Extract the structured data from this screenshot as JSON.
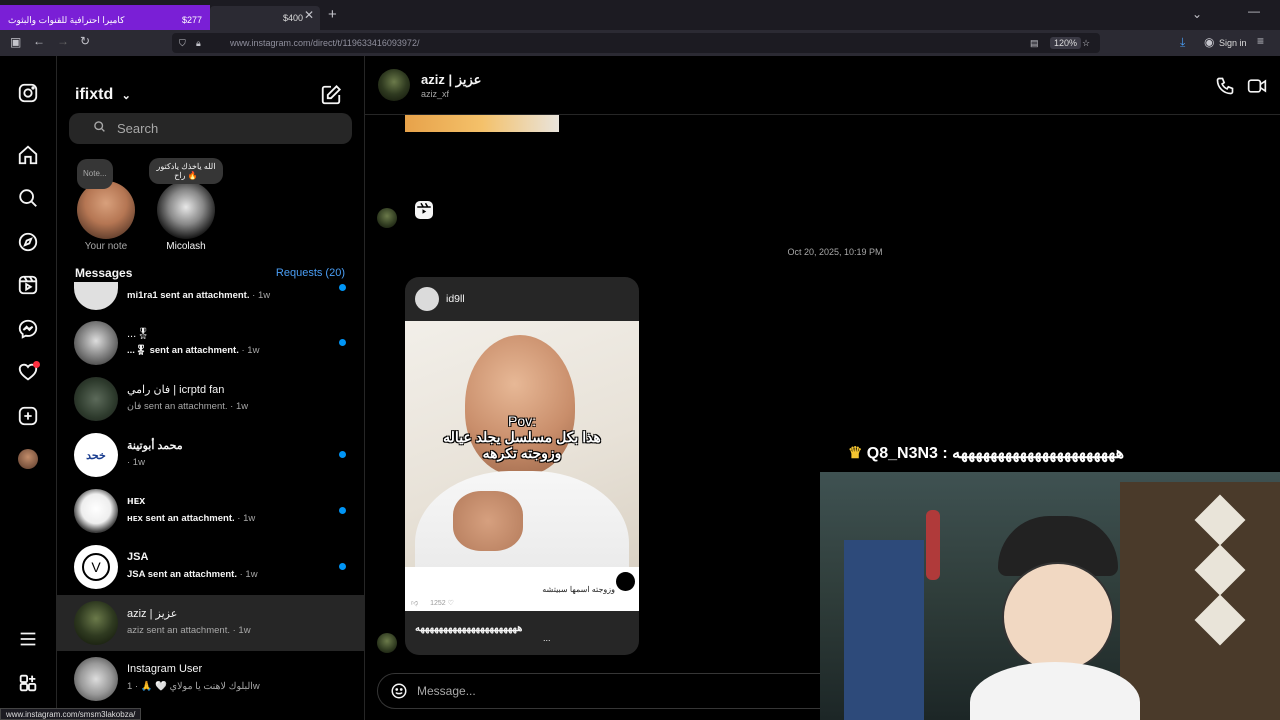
{
  "browser": {
    "ad": {
      "text": "كاميرا احترافية للقنوات والبثوث",
      "price": "$277"
    },
    "tab_price": "$400",
    "url": "www.instagram.com/direct/t/119633416093972/",
    "zoom": "120%",
    "sign_in": "Sign in",
    "status_url": "www.instagram.com/smsm3lakobza/"
  },
  "sidebar": {
    "username": "ifixtd",
    "search_placeholder": "Search",
    "notes": [
      {
        "bubble": "Note...",
        "label": "Your note"
      },
      {
        "bubble": "الله ياخذك يادكتور راح 🔥",
        "label": "Micolash"
      }
    ],
    "messages_heading": "Messages",
    "requests": "Requests (20)",
    "conversations": [
      {
        "name": "",
        "sub": "mi1ra1 sent an attachment.",
        "time": "· 1w",
        "unread": true
      },
      {
        "name": "...🎖",
        "sub": "...🎖 sent an attachment.",
        "time": "· 1w",
        "unread": true
      },
      {
        "name": "فان رامي | icrptd fan",
        "sub": "فان sent an attachment.",
        "time": "· 1w",
        "unread": false
      },
      {
        "name": "محمد أبوتينة",
        "sub": "",
        "time": "· 1w",
        "unread": true
      },
      {
        "name": "ʜᴇx",
        "sub": "ʜᴇx sent an attachment.",
        "time": "· 1w",
        "unread": true
      },
      {
        "name": "JSA",
        "sub": "JSA sent an attachment.",
        "time": "· 1w",
        "unread": true
      },
      {
        "name": "aziz | عزيز",
        "sub": "aziz sent an attachment.",
        "time": "· 1w",
        "unread": false,
        "active": true
      },
      {
        "name": "Instagram User",
        "sub": "البلوك لاهنت يا مولاي 🤍 🙏",
        "time": "· 1w",
        "unread": false
      }
    ]
  },
  "chat": {
    "name": "aziz | عزيز",
    "handle": "aziz_xf",
    "timestamp": "Oct 20, 2025, 10:19 PM",
    "post": {
      "user": "id9ll",
      "overlay_line1": "Pov:",
      "overlay_line2": "هذا بكل مسلسل يجلد عياله",
      "overlay_line3": "وزوجته تكرهه",
      "footer_caption": "وزوجته اسمها سبيتشه",
      "likes": "1252",
      "reply": "ههههههههههههههههههههههه",
      "reply_more": "..."
    },
    "composer_placeholder": "Message..."
  },
  "stream": {
    "chat_line": "Q8_N3N3 : ههههههههههههههههههههههه",
    "crown_icon": "crown-icon"
  }
}
